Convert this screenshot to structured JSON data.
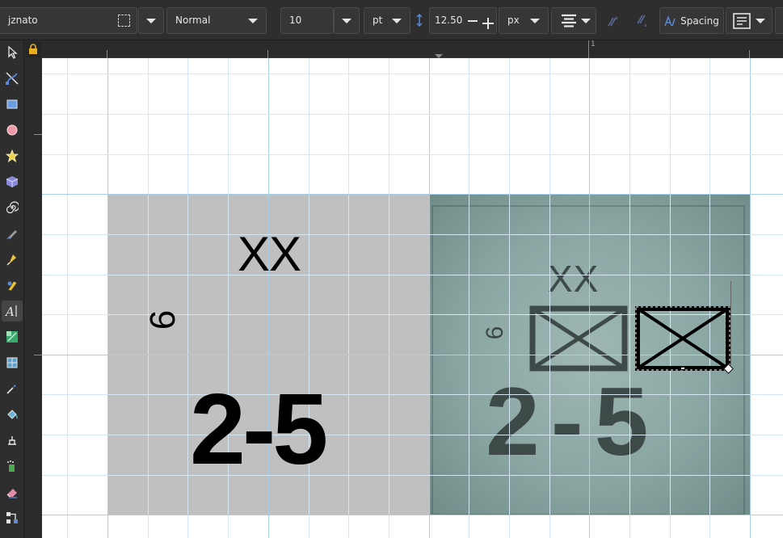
{
  "toolbar": {
    "font_family": "jznato",
    "font_style": "Normal",
    "font_size": "10",
    "font_unit": "pt",
    "line_height": "12.50",
    "spacing_unit": "px",
    "spacing_label": "Spacing"
  },
  "ruler": {
    "top_label": "1"
  },
  "canvas": {
    "left_counter": {
      "formation_size": "XX",
      "unit_id": "6",
      "strength": "2-5",
      "fill": "#c0c0c0"
    },
    "right_counter": {
      "formation_size": "XX",
      "unit_id": "6",
      "strength": "2-5",
      "fill": "#7e9b98"
    }
  },
  "tools": [
    "selector-tool-icon",
    "node-tool-icon",
    "rectangle-tool-icon",
    "ellipse-tool-icon",
    "star-tool-icon",
    "3d-box-tool-icon",
    "spiral-tool-icon",
    "pencil-tool-icon",
    "pen-tool-icon",
    "calligraphy-tool-icon",
    "text-tool-icon",
    "gradient-tool-icon",
    "mesh-tool-icon",
    "dropper-tool-icon",
    "paint-bucket-tool-icon",
    "eraser-tool-icon",
    "spray-tool-icon",
    "tweak-tool-icon",
    "connector-tool-icon"
  ]
}
